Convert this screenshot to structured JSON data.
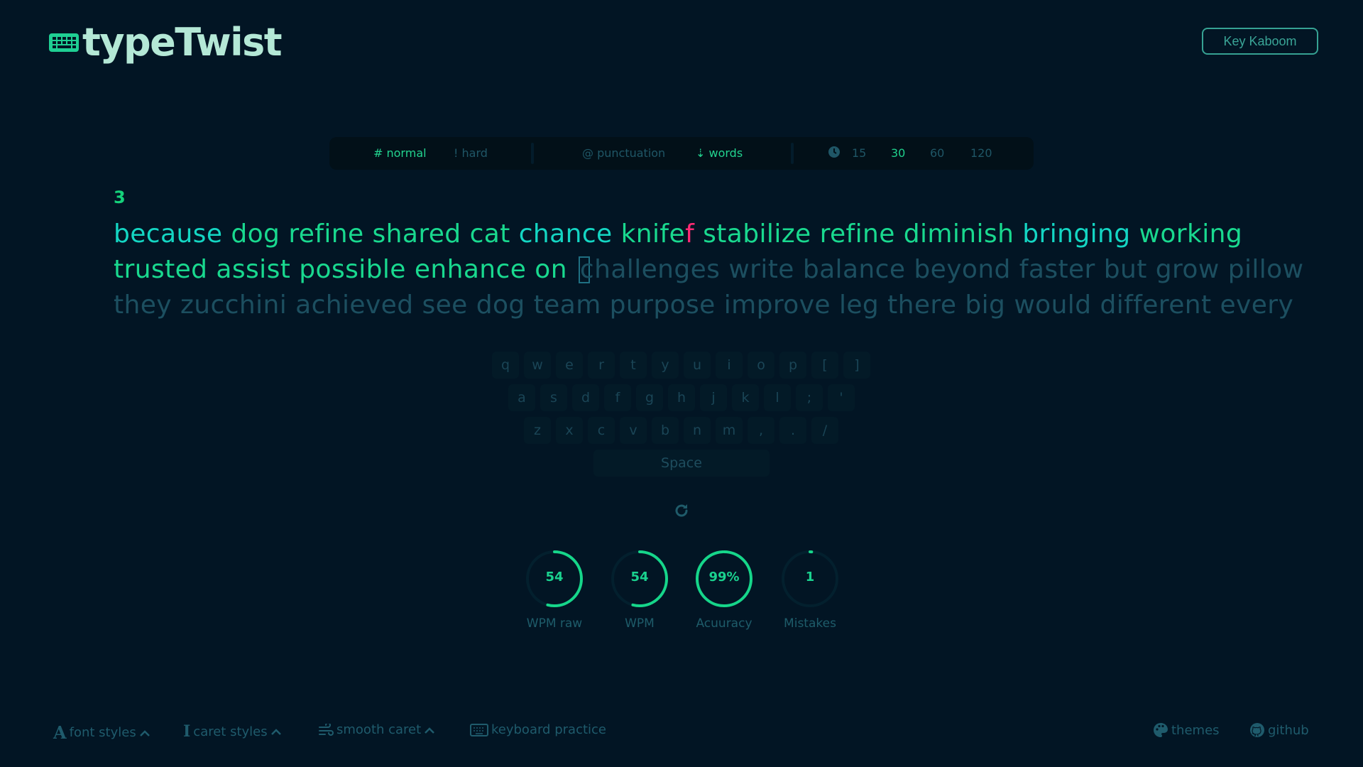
{
  "app": {
    "title": "typeTwist",
    "side_button": "Key Kaboom"
  },
  "config": {
    "difficulty": [
      {
        "symbol": "#",
        "label": "normal",
        "active": true
      },
      {
        "symbol": "!",
        "label": "hard",
        "active": false
      }
    ],
    "options": [
      {
        "label": "punctuation",
        "active": false
      },
      {
        "label": "words",
        "active": true
      }
    ],
    "durations": [
      "15",
      "30",
      "60",
      "120"
    ],
    "selected_duration": "30"
  },
  "typing": {
    "counter": "3",
    "lines": [
      [
        {
          "text": "because",
          "state": "correct"
        },
        {
          "text": "dog",
          "state": "correct"
        },
        {
          "text": "refine",
          "state": "correct"
        },
        {
          "text": "shared",
          "state": "correct"
        },
        {
          "text": "cat",
          "state": "correct"
        },
        {
          "text": "chance",
          "state": "correct"
        },
        {
          "text": "knife",
          "state": "correct",
          "extra": "f"
        },
        {
          "text": "stabilize",
          "state": "correct"
        },
        {
          "text": "refine",
          "state": "correct"
        },
        {
          "text": "diminish",
          "state": "correct"
        },
        {
          "text": "bringing",
          "state": "correct"
        },
        {
          "text": "working",
          "state": "correct"
        }
      ],
      [
        {
          "text": "trusted",
          "state": "correct"
        },
        {
          "text": "assist",
          "state": "correct"
        },
        {
          "text": "possible",
          "state": "correct"
        },
        {
          "text": "enhance",
          "state": "correct"
        },
        {
          "text": "on",
          "state": "correct"
        },
        {
          "text": "challenges",
          "state": "pending"
        },
        {
          "text": "write",
          "state": "pending"
        },
        {
          "text": "balance",
          "state": "pending"
        },
        {
          "text": "beyond",
          "state": "pending"
        },
        {
          "text": "faster",
          "state": "pending"
        },
        {
          "text": "but",
          "state": "pending"
        },
        {
          "text": "grow",
          "state": "pending"
        },
        {
          "text": "pillow",
          "state": "pending"
        }
      ],
      [
        {
          "text": "they",
          "state": "pending"
        },
        {
          "text": "zucchini",
          "state": "pending"
        },
        {
          "text": "achieved",
          "state": "pending"
        },
        {
          "text": "see",
          "state": "pending"
        },
        {
          "text": "dog",
          "state": "pending"
        },
        {
          "text": "team",
          "state": "pending"
        },
        {
          "text": "purpose",
          "state": "pending"
        },
        {
          "text": "improve",
          "state": "pending"
        },
        {
          "text": "leg",
          "state": "pending"
        },
        {
          "text": "there",
          "state": "pending"
        },
        {
          "text": "big",
          "state": "pending"
        },
        {
          "text": "would",
          "state": "pending"
        },
        {
          "text": "different",
          "state": "pending"
        },
        {
          "text": "every",
          "state": "pending"
        }
      ]
    ]
  },
  "keyboard": {
    "rows": [
      [
        "q",
        "w",
        "e",
        "r",
        "t",
        "y",
        "u",
        "i",
        "o",
        "p",
        "[",
        "]"
      ],
      [
        "a",
        "s",
        "d",
        "f",
        "g",
        "h",
        "j",
        "k",
        "l",
        ";",
        "'"
      ],
      [
        "z",
        "x",
        "c",
        "v",
        "b",
        "n",
        "m",
        ",",
        ".",
        "/"
      ]
    ],
    "space": "Space"
  },
  "stats": [
    {
      "value": "54",
      "label": "WPM raw",
      "fraction": 0.54
    },
    {
      "value": "54",
      "label": "WPM",
      "fraction": 0.54
    },
    {
      "value": "99%",
      "label": "Acuuracy",
      "fraction": 0.99
    },
    {
      "value": "1",
      "label": "Mistakes",
      "fraction": 0.01
    }
  ],
  "footer": {
    "font_styles": "font styles",
    "caret_styles": "caret styles",
    "smooth_caret": "smooth caret",
    "keyboard_practice": "keyboard practice",
    "themes": "themes",
    "github": "github"
  },
  "colors": {
    "accent": "#19d98f",
    "cyan": "#14d6c3",
    "error": "#ff2a74",
    "pending": "#1c4f60",
    "background": "#021524"
  }
}
